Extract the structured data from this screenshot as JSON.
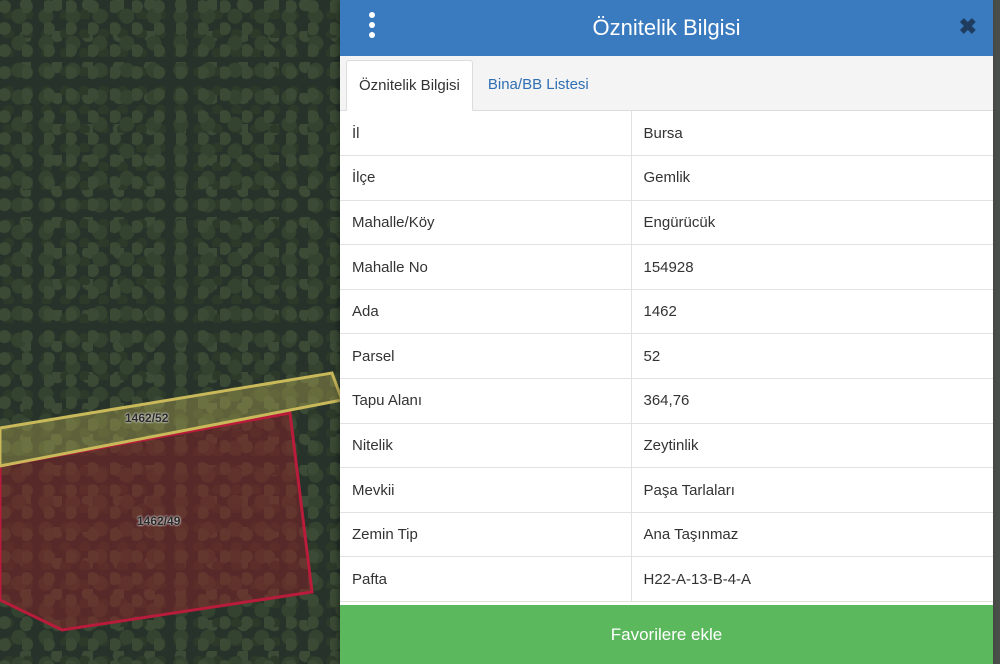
{
  "map": {
    "parcels": [
      {
        "label": "1462/52"
      },
      {
        "label": "1462/49"
      }
    ]
  },
  "panel": {
    "title": "Öznitelik Bilgisi",
    "close_symbol": "✖",
    "tabs": [
      {
        "label": "Öznitelik Bilgisi",
        "active": true
      },
      {
        "label": "Bina/BB Listesi",
        "active": false
      }
    ],
    "rows": [
      {
        "key": "İl",
        "value": "Bursa"
      },
      {
        "key": "İlçe",
        "value": "Gemlik"
      },
      {
        "key": "Mahalle/Köy",
        "value": "Engürücük"
      },
      {
        "key": "Mahalle No",
        "value": "154928"
      },
      {
        "key": "Ada",
        "value": "1462"
      },
      {
        "key": "Parsel",
        "value": "52"
      },
      {
        "key": "Tapu Alanı",
        "value": "364,76"
      },
      {
        "key": "Nitelik",
        "value": "Zeytinlik"
      },
      {
        "key": "Mevkii",
        "value": "Paşa Tarlaları"
      },
      {
        "key": "Zemin Tip",
        "value": "Ana Taşınmaz"
      },
      {
        "key": "Pafta",
        "value": "H22-A-13-B-4-A"
      }
    ],
    "favorite_button": "Favorilere ekle"
  },
  "colors": {
    "header": "#3a7abf",
    "button": "#5cb85c",
    "parcel_selected": "#c9b95a",
    "parcel_other": "#b81c3a"
  },
  "icons": {
    "menu": "vertical-dots-icon",
    "close": "close-icon"
  }
}
